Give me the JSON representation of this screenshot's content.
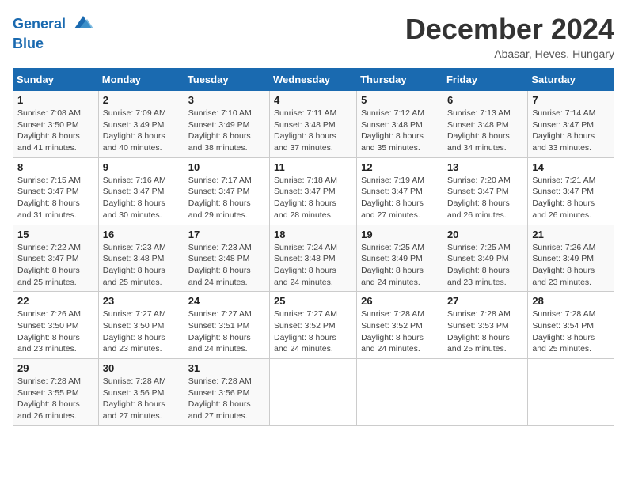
{
  "header": {
    "logo_line1": "General",
    "logo_line2": "Blue",
    "month": "December 2024",
    "location": "Abasar, Heves, Hungary"
  },
  "days_of_week": [
    "Sunday",
    "Monday",
    "Tuesday",
    "Wednesday",
    "Thursday",
    "Friday",
    "Saturday"
  ],
  "weeks": [
    [
      {
        "day": "1",
        "text": "Sunrise: 7:08 AM\nSunset: 3:50 PM\nDaylight: 8 hours\nand 41 minutes."
      },
      {
        "day": "2",
        "text": "Sunrise: 7:09 AM\nSunset: 3:49 PM\nDaylight: 8 hours\nand 40 minutes."
      },
      {
        "day": "3",
        "text": "Sunrise: 7:10 AM\nSunset: 3:49 PM\nDaylight: 8 hours\nand 38 minutes."
      },
      {
        "day": "4",
        "text": "Sunrise: 7:11 AM\nSunset: 3:48 PM\nDaylight: 8 hours\nand 37 minutes."
      },
      {
        "day": "5",
        "text": "Sunrise: 7:12 AM\nSunset: 3:48 PM\nDaylight: 8 hours\nand 35 minutes."
      },
      {
        "day": "6",
        "text": "Sunrise: 7:13 AM\nSunset: 3:48 PM\nDaylight: 8 hours\nand 34 minutes."
      },
      {
        "day": "7",
        "text": "Sunrise: 7:14 AM\nSunset: 3:47 PM\nDaylight: 8 hours\nand 33 minutes."
      }
    ],
    [
      {
        "day": "8",
        "text": "Sunrise: 7:15 AM\nSunset: 3:47 PM\nDaylight: 8 hours\nand 31 minutes."
      },
      {
        "day": "9",
        "text": "Sunrise: 7:16 AM\nSunset: 3:47 PM\nDaylight: 8 hours\nand 30 minutes."
      },
      {
        "day": "10",
        "text": "Sunrise: 7:17 AM\nSunset: 3:47 PM\nDaylight: 8 hours\nand 29 minutes."
      },
      {
        "day": "11",
        "text": "Sunrise: 7:18 AM\nSunset: 3:47 PM\nDaylight: 8 hours\nand 28 minutes."
      },
      {
        "day": "12",
        "text": "Sunrise: 7:19 AM\nSunset: 3:47 PM\nDaylight: 8 hours\nand 27 minutes."
      },
      {
        "day": "13",
        "text": "Sunrise: 7:20 AM\nSunset: 3:47 PM\nDaylight: 8 hours\nand 26 minutes."
      },
      {
        "day": "14",
        "text": "Sunrise: 7:21 AM\nSunset: 3:47 PM\nDaylight: 8 hours\nand 26 minutes."
      }
    ],
    [
      {
        "day": "15",
        "text": "Sunrise: 7:22 AM\nSunset: 3:47 PM\nDaylight: 8 hours\nand 25 minutes."
      },
      {
        "day": "16",
        "text": "Sunrise: 7:23 AM\nSunset: 3:48 PM\nDaylight: 8 hours\nand 25 minutes."
      },
      {
        "day": "17",
        "text": "Sunrise: 7:23 AM\nSunset: 3:48 PM\nDaylight: 8 hours\nand 24 minutes."
      },
      {
        "day": "18",
        "text": "Sunrise: 7:24 AM\nSunset: 3:48 PM\nDaylight: 8 hours\nand 24 minutes."
      },
      {
        "day": "19",
        "text": "Sunrise: 7:25 AM\nSunset: 3:49 PM\nDaylight: 8 hours\nand 24 minutes."
      },
      {
        "day": "20",
        "text": "Sunrise: 7:25 AM\nSunset: 3:49 PM\nDaylight: 8 hours\nand 23 minutes."
      },
      {
        "day": "21",
        "text": "Sunrise: 7:26 AM\nSunset: 3:49 PM\nDaylight: 8 hours\nand 23 minutes."
      }
    ],
    [
      {
        "day": "22",
        "text": "Sunrise: 7:26 AM\nSunset: 3:50 PM\nDaylight: 8 hours\nand 23 minutes."
      },
      {
        "day": "23",
        "text": "Sunrise: 7:27 AM\nSunset: 3:50 PM\nDaylight: 8 hours\nand 23 minutes."
      },
      {
        "day": "24",
        "text": "Sunrise: 7:27 AM\nSunset: 3:51 PM\nDaylight: 8 hours\nand 24 minutes."
      },
      {
        "day": "25",
        "text": "Sunrise: 7:27 AM\nSunset: 3:52 PM\nDaylight: 8 hours\nand 24 minutes."
      },
      {
        "day": "26",
        "text": "Sunrise: 7:28 AM\nSunset: 3:52 PM\nDaylight: 8 hours\nand 24 minutes."
      },
      {
        "day": "27",
        "text": "Sunrise: 7:28 AM\nSunset: 3:53 PM\nDaylight: 8 hours\nand 25 minutes."
      },
      {
        "day": "28",
        "text": "Sunrise: 7:28 AM\nSunset: 3:54 PM\nDaylight: 8 hours\nand 25 minutes."
      }
    ],
    [
      {
        "day": "29",
        "text": "Sunrise: 7:28 AM\nSunset: 3:55 PM\nDaylight: 8 hours\nand 26 minutes."
      },
      {
        "day": "30",
        "text": "Sunrise: 7:28 AM\nSunset: 3:56 PM\nDaylight: 8 hours\nand 27 minutes."
      },
      {
        "day": "31",
        "text": "Sunrise: 7:28 AM\nSunset: 3:56 PM\nDaylight: 8 hours\nand 27 minutes."
      },
      {
        "day": "",
        "text": ""
      },
      {
        "day": "",
        "text": ""
      },
      {
        "day": "",
        "text": ""
      },
      {
        "day": "",
        "text": ""
      }
    ]
  ]
}
